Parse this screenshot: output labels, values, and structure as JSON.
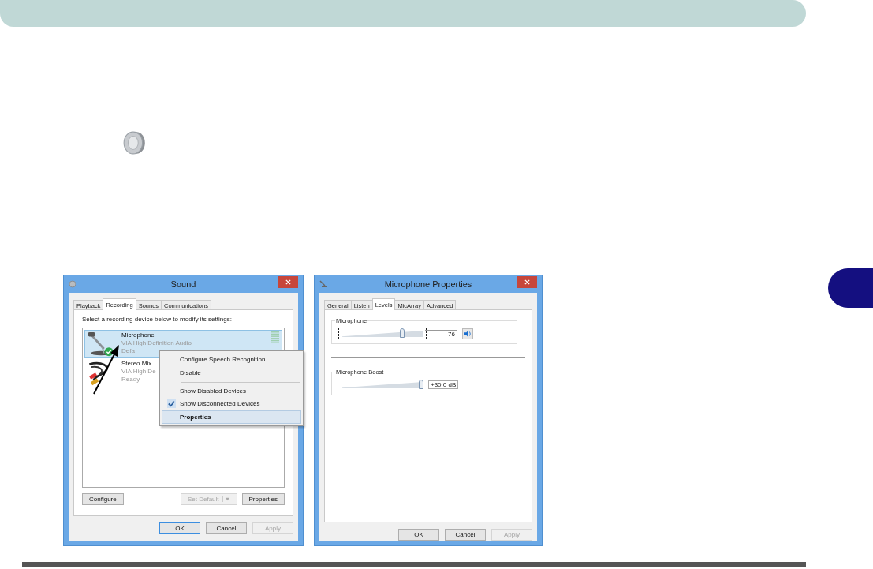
{
  "sound_window": {
    "title": "Sound",
    "tabs": [
      {
        "label": "Playback",
        "selected": false
      },
      {
        "label": "Recording",
        "selected": true
      },
      {
        "label": "Sounds",
        "selected": false
      },
      {
        "label": "Communications",
        "selected": false
      }
    ],
    "instruction": "Select a recording device below to modify its settings:",
    "devices": [
      {
        "kind": "microphone",
        "name": "Microphone",
        "driver": "VIA High Definition Audio",
        "status": "Defa",
        "default": true,
        "selected": true
      },
      {
        "kind": "cable",
        "name": "Stereo Mix",
        "driver": "VIA High De",
        "status": "Ready",
        "default": false,
        "selected": false
      }
    ],
    "panel_buttons": [
      {
        "kind": "plain",
        "label": "Configure",
        "disabled": false
      },
      {
        "kind": "split",
        "label": "Set Default",
        "disabled": true
      },
      {
        "kind": "plain",
        "label": "Properties",
        "disabled": false
      }
    ],
    "dialog_buttons": [
      {
        "label": "OK",
        "disabled": false,
        "focused": true
      },
      {
        "label": "Cancel",
        "disabled": false,
        "focused": false
      },
      {
        "label": "Apply",
        "disabled": true,
        "focused": false
      }
    ]
  },
  "context_menu": {
    "items": [
      {
        "label": "Configure Speech Recognition",
        "checked": false,
        "selected": false,
        "bold": false,
        "separator_before": false
      },
      {
        "label": "Disable",
        "checked": false,
        "selected": false,
        "bold": false,
        "separator_before": false
      },
      {
        "label": "Show Disabled Devices",
        "checked": false,
        "selected": false,
        "bold": false,
        "separator_before": true
      },
      {
        "label": "Show Disconnected Devices",
        "checked": true,
        "selected": false,
        "bold": false,
        "separator_before": false
      },
      {
        "label": "Properties",
        "checked": false,
        "selected": true,
        "bold": true,
        "separator_before": false
      }
    ]
  },
  "properties_window": {
    "title": "Microphone Properties",
    "tabs": [
      {
        "label": "General",
        "selected": false
      },
      {
        "label": "Listen",
        "selected": false
      },
      {
        "label": "Levels",
        "selected": true
      },
      {
        "label": "MicArray",
        "selected": false
      },
      {
        "label": "Advanced",
        "selected": false
      }
    ],
    "levels": [
      {
        "kind": "volume",
        "label": "Microphone",
        "level": 0.76,
        "reading": "76",
        "focused": true,
        "muted": false
      },
      {
        "kind": "boost",
        "label": "Microphone Boost",
        "level": 1,
        "reading": "+30.0 dB",
        "focused": false
      }
    ],
    "dialog_buttons": [
      {
        "label": "OK",
        "disabled": false,
        "focused": false
      },
      {
        "label": "Cancel",
        "disabled": false,
        "focused": false
      },
      {
        "label": "Apply",
        "disabled": true,
        "focused": false
      }
    ]
  }
}
